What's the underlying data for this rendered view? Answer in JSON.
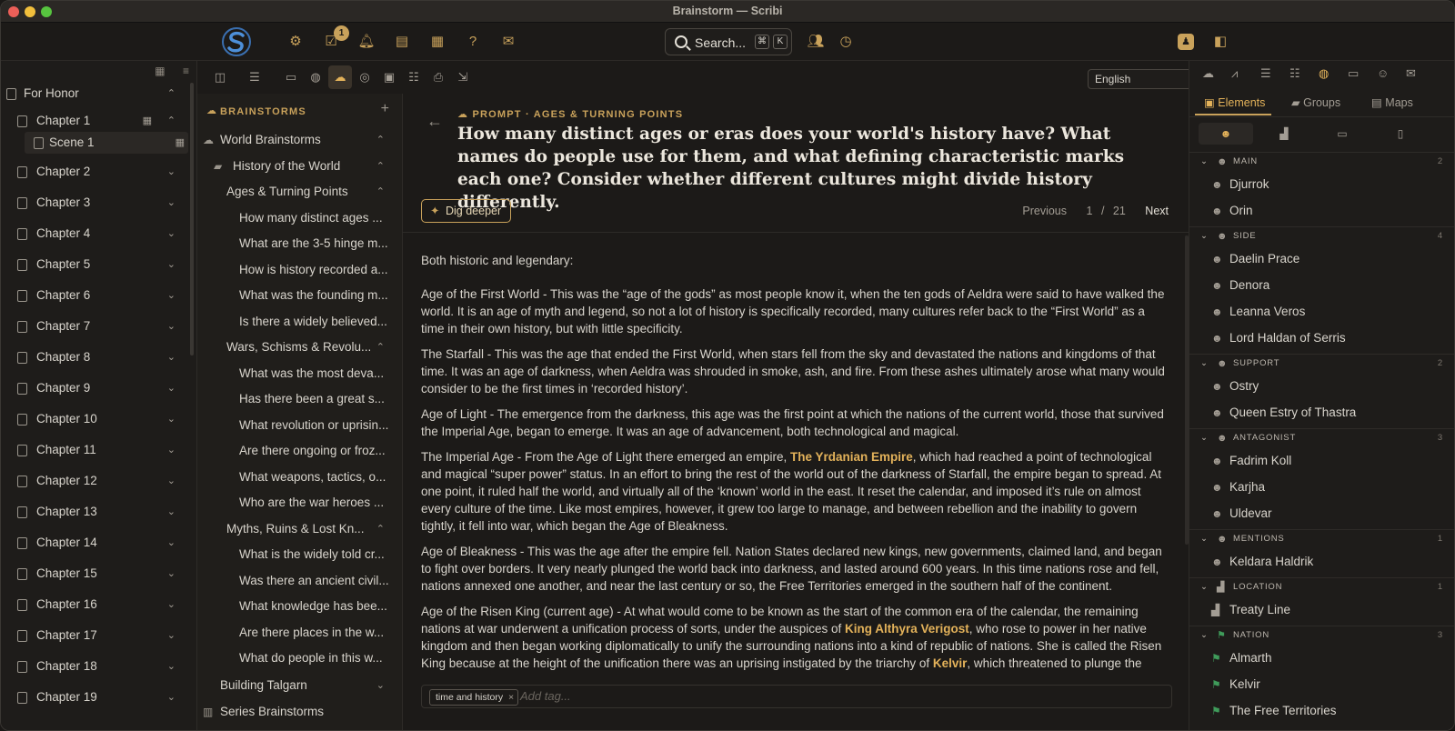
{
  "window": {
    "title": "Brainstorm — Scribi"
  },
  "toolbar": {
    "badge_count": "1",
    "search": {
      "label": "Search...",
      "key1": "⌘",
      "key2": "K"
    }
  },
  "language": {
    "selected": "English"
  },
  "sidebar": {
    "book": "For Honor",
    "items": [
      {
        "label": "Chapter 1"
      },
      {
        "label": "Scene 1"
      },
      {
        "label": "Chapter 2"
      },
      {
        "label": "Chapter 3"
      },
      {
        "label": "Chapter 4"
      },
      {
        "label": "Chapter 5"
      },
      {
        "label": "Chapter 6"
      },
      {
        "label": "Chapter 7"
      },
      {
        "label": "Chapter 8"
      },
      {
        "label": "Chapter 9"
      },
      {
        "label": "Chapter 10"
      },
      {
        "label": "Chapter 11"
      },
      {
        "label": "Chapter 12"
      },
      {
        "label": "Chapter 13"
      },
      {
        "label": "Chapter 14"
      },
      {
        "label": "Chapter 15"
      },
      {
        "label": "Chapter 16"
      },
      {
        "label": "Chapter 17"
      },
      {
        "label": "Chapter 18"
      },
      {
        "label": "Chapter 19"
      }
    ]
  },
  "brainstorms": {
    "heading": "BRAINSTORMS",
    "items": [
      {
        "label": "World Brainstorms"
      },
      {
        "label": "History of the World"
      },
      {
        "label": "Ages & Turning Points"
      },
      {
        "label": "How many distinct ages ..."
      },
      {
        "label": "What are the 3-5 hinge m..."
      },
      {
        "label": "How is history recorded a..."
      },
      {
        "label": "What was the founding m..."
      },
      {
        "label": "Is there a widely believed..."
      },
      {
        "label": "Wars, Schisms & Revolu..."
      },
      {
        "label": "What was the most deva..."
      },
      {
        "label": "Has there been a great s..."
      },
      {
        "label": "What revolution or uprisin..."
      },
      {
        "label": "Are there ongoing or froz..."
      },
      {
        "label": "What weapons, tactics, o..."
      },
      {
        "label": "Who are the war heroes ..."
      },
      {
        "label": "Myths, Ruins & Lost Kn..."
      },
      {
        "label": "What is the widely told cr..."
      },
      {
        "label": "Was there an ancient civil..."
      },
      {
        "label": "What knowledge has bee..."
      },
      {
        "label": "Are there places in the w..."
      },
      {
        "label": "What do people in this w..."
      },
      {
        "label": "Building Talgarn"
      },
      {
        "label": "Series Brainstorms"
      }
    ]
  },
  "editor": {
    "breadcrumb": "PROMPT · AGES & TURNING POINTS",
    "prompt": "How many distinct ages or eras does your world's history have? What names do people use for them, and what defining characteristic marks each one? Consider whether different cultures might divide history differently.",
    "dig_deeper": "Dig deeper",
    "pager": {
      "previous": "Previous",
      "current": "1",
      "sep": "/",
      "total": "21",
      "next": "Next"
    },
    "intro": "Both historic and legendary:",
    "p1": "Age of the First World - This was the “age of the gods” as most people know it, when the ten gods of Aeldra were said to have walked the world. It is an age of myth and legend, so not a lot of history is specifically recorded, many cultures refer back to the “First World” as a time in their own history, but with little specificity.",
    "p2": "The Starfall - This was the age that ended the First World, when stars fell from the sky and devastated the nations and kingdoms of that time. It was an age of darkness, when Aeldra was shrouded in smoke, ash, and fire. From these ashes ultimately arose what many would consider to be the first times in ‘recorded history’.",
    "p3": "Age of Light - The emergence from the darkness, this age was the first point at which the nations of the current world, those that survived the Imperial Age, began to emerge. It was an age of advancement, both technological and magical.",
    "p4a": "The Imperial Age - From the Age of Light there emerged an empire, ",
    "p4hl": "The Yrdanian Empire",
    "p4b": ", which had reached a point of technological and magical “super power” status. In an effort to bring the rest of the world out of the darkness of Starfall, the empire began to spread. At one point, it ruled half the world, and virtually all of the ‘known’ world in the east. It reset the calendar, and imposed it’s rule on almost every culture of the time. Like most empires, however, it grew too large to manage, and between rebellion and the inability to govern tightly, it fell into war, which began the Age of Bleakness.",
    "p5": "Age of Bleakness - This was the age after the empire fell. Nation States declared new kings, new governments, claimed land, and began to fight over borders. It very nearly plunged the world back into darkness, and lasted around 600 years. In this time nations rose and fell, nations annexed one another, and near the last century or so, the Free Territories emerged in the southern half of the continent.",
    "p6a": "Age of the Risen King (current age) - At what would come to be known as the start of the common era of the calendar, the remaining nations at war underwent a unification process of sorts, under the auspices of ",
    "p6hl1": "King Althyra Verigost",
    "p6b": ", who rose to power in her native kingdom and then began working diplomatically to unify the surrounding nations into a kind of republic of nations. She is called the Risen King because at the height of the unification there was an uprising instigated by the triarchy of ",
    "p6hl2": "Kelvir",
    "p6c": ", which threatened to plunge the",
    "tag": "time and history",
    "tag_placeholder": "Add tag..."
  },
  "right_panel": {
    "tabs": [
      {
        "label": "Elements"
      },
      {
        "label": "Groups"
      },
      {
        "label": "Maps"
      }
    ],
    "groups": [
      {
        "name": "MAIN",
        "count": "2",
        "items": [
          "Djurrok",
          "Orin"
        ]
      },
      {
        "name": "SIDE",
        "count": "4",
        "items": [
          "Daelin Prace",
          "Denora",
          "Leanna Veros",
          "Lord Haldan of Serris"
        ]
      },
      {
        "name": "SUPPORT",
        "count": "2",
        "items": [
          "Ostry",
          "Queen Estry of Thastra"
        ]
      },
      {
        "name": "ANTAGONIST",
        "count": "3",
        "items": [
          "Fadrim Koll",
          "Karjha",
          "Uldevar"
        ]
      },
      {
        "name": "MENTIONS",
        "count": "1",
        "items": [
          "Keldara Haldrik"
        ]
      },
      {
        "name": "LOCATION",
        "count": "1",
        "items": [
          "Treaty Line"
        ]
      },
      {
        "name": "NATION",
        "count": "3",
        "items": [
          "Almarth",
          "Kelvir",
          "The Free Territories"
        ]
      }
    ]
  },
  "colors": {
    "accent": "#c9a25b",
    "highlight": "#e3b25a",
    "background": "#1c1a18",
    "nation_flag": "#3f9b5a"
  }
}
